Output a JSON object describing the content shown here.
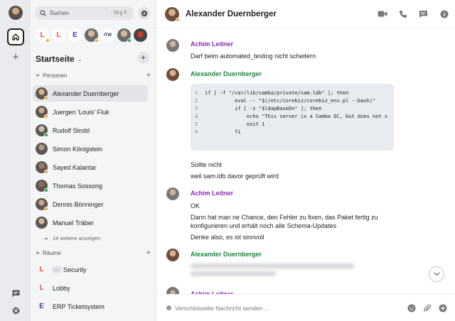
{
  "search": {
    "placeholder": "Suchen",
    "shortcut": "Strg K"
  },
  "recents": [
    {
      "letter": "L",
      "color": "#e84e2e"
    },
    {
      "letter": "L",
      "color": "#e84e2e"
    },
    {
      "letter": "E",
      "color": "#4b3bb0"
    }
  ],
  "space": {
    "title": "Startseite"
  },
  "people_section": {
    "label": "Personen"
  },
  "people": [
    {
      "name": "Alexander Duernberger",
      "status": "#f5a623",
      "face": "#d9b08c"
    },
    {
      "name": "Juergen 'Louis' Fluk",
      "status": "#f5a623",
      "face": "#c9a88a"
    },
    {
      "name": "Rudolf Strobl",
      "status": "#2aa745",
      "face": "#c8c0b8"
    },
    {
      "name": "Simon Königstein",
      "status": "",
      "face": "#b89a80"
    },
    {
      "name": "Sayed Kalantar",
      "status": "#f5a623",
      "face": "#a07a5c"
    },
    {
      "name": "Thomas Sossong",
      "status": "#2aa745",
      "face": "#8a6e5a"
    },
    {
      "name": "Dennis Bönninger",
      "status": "#f5a623",
      "face": "#c9a88a"
    },
    {
      "name": "Manuel Träber",
      "status": "",
      "face": "#d6b79a"
    }
  ],
  "people_more": "14 weitere anzeigen",
  "rooms_section": {
    "label": "Räume"
  },
  "rooms": [
    {
      "letter": "L",
      "color": "#e84e2e",
      "name": "Security",
      "blurred_prefix": true
    },
    {
      "letter": "L",
      "color": "#e84e2e",
      "name": "Lobby",
      "blurred_prefix": false
    },
    {
      "letter": "E",
      "color": "#4b3bb0",
      "name": "ERP Ticketsystem",
      "blurred_prefix": false
    }
  ],
  "header": {
    "name": "Alexander Duernberger"
  },
  "messages": {
    "m1": {
      "sender": "Achim Leitner",
      "text": "Darf beim automated_testing nicht scheitern"
    },
    "m2": {
      "sender": "Alexander Duernberger",
      "code": [
        {
          "n": "1",
          "t": "if [ -f \"/var/lib/samba/private/sam.ldb\" ]; then"
        },
        {
          "n": "2",
          "t": "          eval -- \"$(/etc/corebiz/corebiz_env.pl --bash)\""
        },
        {
          "n": "3",
          "t": "          if [ -z \"$ldapBaseDn\" ]; then"
        },
        {
          "n": "4",
          "t": "              echo \"This server is a Samba DC, but does not s"
        },
        {
          "n": "5",
          "t": "              exit 1"
        },
        {
          "n": "6",
          "t": "          fi"
        }
      ],
      "after1": "Sollte nicht",
      "after2": "weil sam.ldb davor geprüft wird"
    },
    "m3": {
      "sender": "Achim Leitner",
      "l1": "OK",
      "l2": "Dann hat man ne Chance, den Fehler zu fixen, das Paket fertig zu",
      "l3": "konfigurieren und erhält noch alle Schema-Updates",
      "l4": "Denke also, es ist sinnvoll"
    },
    "m4": {
      "sender": "Alexander Duernberger"
    },
    "m5": {
      "sender": "Achim Leitner"
    }
  },
  "composer": {
    "placeholder": "Verschlüsselte Nachricht senden …"
  },
  "colors": {
    "purple": "#8c29b8",
    "green": "#138a3e",
    "away": "#f5a623",
    "online": "#2aa745"
  }
}
